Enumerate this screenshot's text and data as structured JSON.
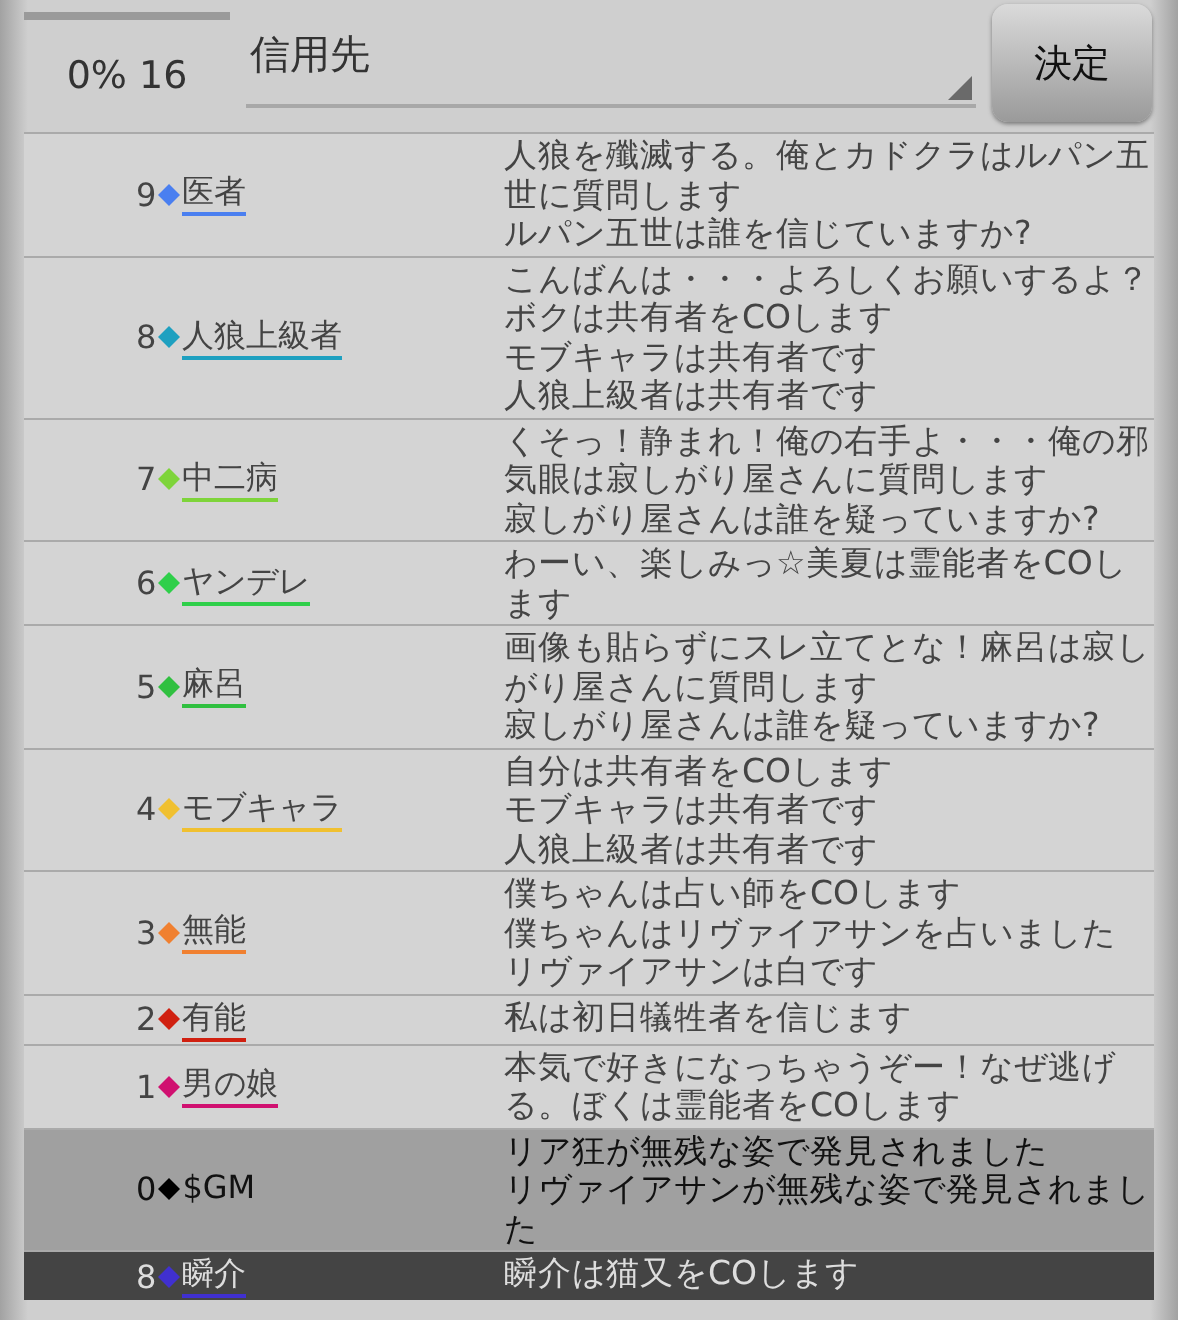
{
  "header": {
    "status": "0% 16",
    "target_select": {
      "value": "信用先"
    },
    "confirm_button": "決定"
  },
  "messages": [
    {
      "kind": "player",
      "number": "9",
      "name": "医者",
      "color": "#4a7ff0",
      "lines": [
        "人狼を殲滅する。俺とカドクラはルパン五世に質問します",
        "ルパン五世は誰を信じていますか?"
      ]
    },
    {
      "kind": "player",
      "number": "8",
      "name": "人狼上級者",
      "color": "#1ea0c0",
      "lines": [
        "こんばんは・・・よろしくお願いするよ？",
        "ボクは共有者をCOします",
        "モブキャラは共有者です",
        "人狼上級者は共有者です"
      ]
    },
    {
      "kind": "player",
      "number": "7",
      "name": "中二病",
      "color": "#7ed43a",
      "lines": [
        "くそっ！静まれ！俺の右手よ・・・俺の邪気眼は寂しがり屋さんに質問します",
        "寂しがり屋さんは誰を疑っていますか?"
      ]
    },
    {
      "kind": "player",
      "number": "6",
      "name": "ヤンデレ",
      "color": "#2fcf4a",
      "lines": [
        "わーい、楽しみっ☆美夏は霊能者をCOします"
      ]
    },
    {
      "kind": "player",
      "number": "5",
      "name": "麻呂",
      "color": "#30c040",
      "lines": [
        "画像も貼らずにスレ立てとな！麻呂は寂しがり屋さんに質問します",
        "寂しがり屋さんは誰を疑っていますか?"
      ]
    },
    {
      "kind": "player",
      "number": "4",
      "name": "モブキャラ",
      "color": "#f0c030",
      "lines": [
        "自分は共有者をCOします",
        "モブキャラは共有者です",
        "人狼上級者は共有者です"
      ]
    },
    {
      "kind": "player",
      "number": "3",
      "name": "無能",
      "color": "#f08030",
      "lines": [
        "僕ちゃんは占い師をCOします",
        "僕ちゃんはリヴァイアサンを占いました",
        "リヴァイアサンは白です"
      ]
    },
    {
      "kind": "player",
      "number": "2",
      "name": "有能",
      "color": "#d02010",
      "lines": [
        "私は初日犠牲者を信じます"
      ]
    },
    {
      "kind": "player",
      "number": "1",
      "name": "男の娘",
      "color": "#d01070",
      "lines": [
        "本気で好きになっちゃうぞー！なぜ逃げる。ぼくは霊能者をCOします"
      ]
    },
    {
      "kind": "system",
      "number": "0",
      "name": "$GM",
      "color": "#000000",
      "lines": [
        "リア狂が無残な姿で発見されました",
        "リヴァイアサンが無残な姿で発見されました"
      ]
    },
    {
      "kind": "highlight",
      "number": "8",
      "name": "瞬介",
      "color": "#4030d0",
      "lines": [
        "瞬介は猫又をCOします"
      ]
    }
  ]
}
